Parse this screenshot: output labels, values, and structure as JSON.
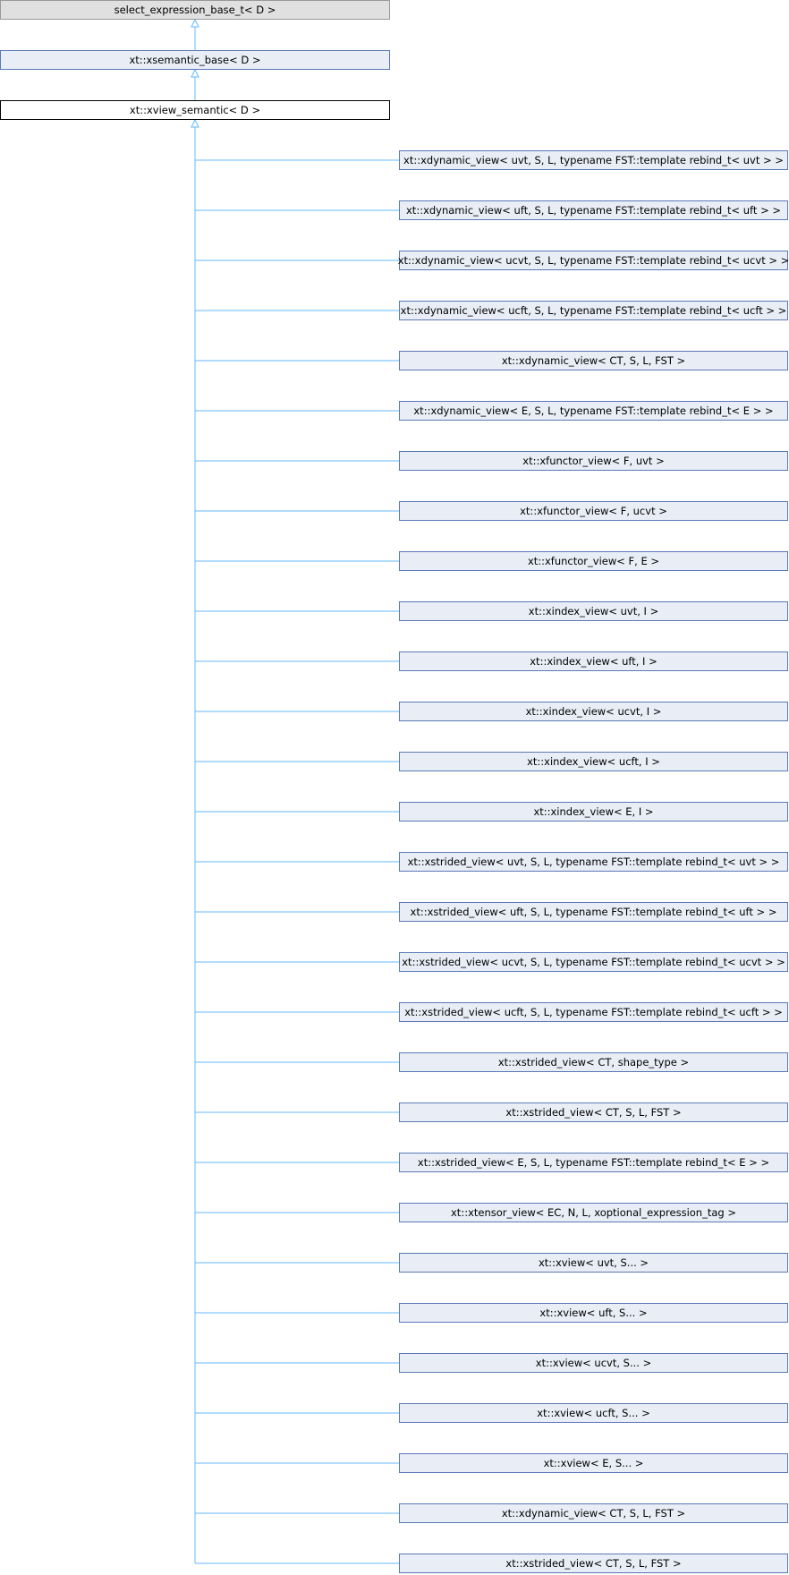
{
  "colors": {
    "edge": "#63b8ff",
    "derived_fill": "#e8edf6",
    "derived_border": "#5a79b6",
    "base_grey_fill": "#e0e0e0",
    "base_grey_border": "#999999",
    "current_fill": "#ffffff",
    "current_border": "#000000"
  },
  "ancestors": [
    {
      "label": "select_expression_base_t< D >",
      "style": "grey"
    },
    {
      "label": "xt::xsemantic_base< D >",
      "style": "derived"
    }
  ],
  "current": {
    "label": "xt::xview_semantic< D >"
  },
  "derived": [
    "xt::xdynamic_view< uvt, S, L, typename FST::template rebind_t< uvt > >",
    "xt::xdynamic_view< uft, S, L, typename FST::template rebind_t< uft > >",
    "xt::xdynamic_view< ucvt, S, L, typename FST::template rebind_t< ucvt > >",
    "xt::xdynamic_view< ucft, S, L, typename FST::template rebind_t< ucft > >",
    "xt::xdynamic_view< CT, S, L, FST >",
    "xt::xdynamic_view< E, S, L, typename FST::template rebind_t< E > >",
    "xt::xfunctor_view< F, uvt >",
    "xt::xfunctor_view< F, ucvt >",
    "xt::xfunctor_view< F, E >",
    "xt::xindex_view< uvt, I >",
    "xt::xindex_view< uft, I >",
    "xt::xindex_view< ucvt, I >",
    "xt::xindex_view< ucft, I >",
    "xt::xindex_view< E, I >",
    "xt::xstrided_view< uvt, S, L, typename FST::template rebind_t< uvt > >",
    "xt::xstrided_view< uft, S, L, typename FST::template rebind_t< uft > >",
    "xt::xstrided_view< ucvt, S, L, typename FST::template rebind_t< ucvt > >",
    "xt::xstrided_view< ucft, S, L, typename FST::template rebind_t< ucft > >",
    "xt::xstrided_view< CT, shape_type >",
    "xt::xstrided_view< CT, S, L, FST >",
    "xt::xstrided_view< E, S, L, typename FST::template rebind_t< E > >",
    "xt::xtensor_view< EC, N, L, xoptional_expression_tag >",
    "xt::xview< uvt, S... >",
    "xt::xview< uft, S... >",
    "xt::xview< ucvt, S... >",
    "xt::xview< ucft, S... >",
    "xt::xview< E, S... >",
    "xt::xdynamic_view< CT, S, L, FST >",
    "xt::xstrided_view< CT, S, L, FST >"
  ]
}
